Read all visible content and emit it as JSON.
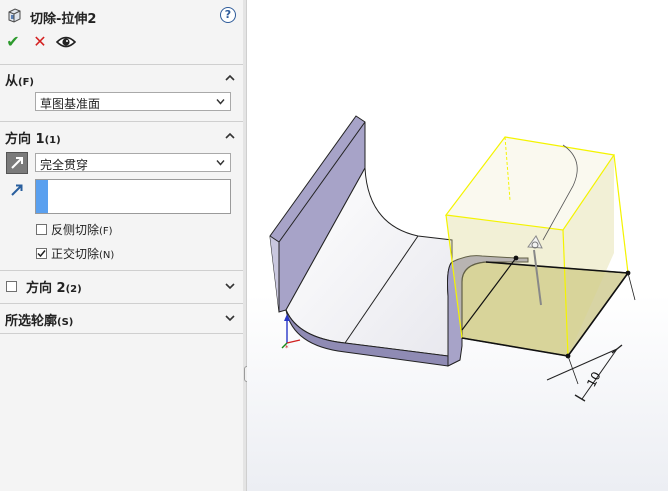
{
  "header": {
    "title": "切除-拉伸2",
    "help_icon": "?"
  },
  "actions": {
    "ok_icon": "✔",
    "cancel_icon": "✕",
    "preview_icon": "eye-icon"
  },
  "from": {
    "title": "从",
    "shortcut": "(F)",
    "value": "草图基准面"
  },
  "direction1": {
    "title": "方向 1",
    "shortcut": "(1)",
    "end_condition": "完全贯穿",
    "reverse_side_label": "反侧切除",
    "reverse_side_shortcut": "(F)",
    "reverse_side_checked": false,
    "normal_cut_label": "正交切除",
    "normal_cut_shortcut": "(N)",
    "normal_cut_checked": true
  },
  "direction2": {
    "title": "方向 2",
    "shortcut": "(2)",
    "checked": false
  },
  "selected_contours": {
    "title": "所选轮廓",
    "shortcut": "(S)"
  },
  "viewport": {
    "dimension_value": "10",
    "accent_yellow": "#f4f400",
    "accent_blue": "#5aa0ef"
  }
}
